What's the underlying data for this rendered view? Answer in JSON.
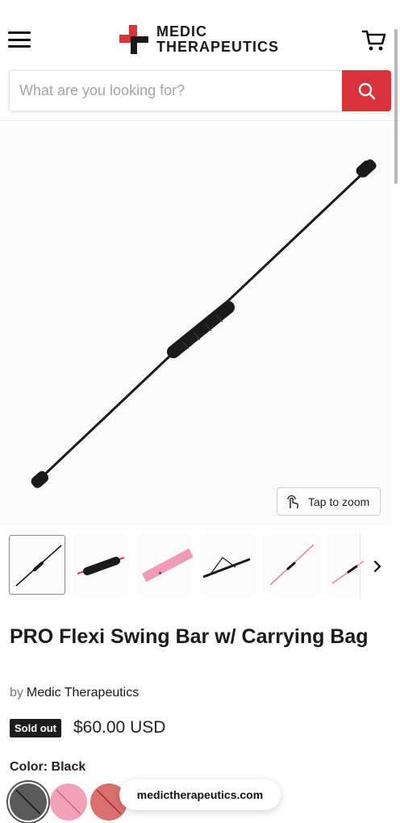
{
  "header": {
    "logo_line1": "MEDIC",
    "logo_line2": "THERAPEUTICS",
    "brand_red": "#d8333a",
    "search": {
      "placeholder": "What are you looking for?",
      "value": ""
    }
  },
  "product": {
    "zoom_label": "Tap to zoom",
    "title": "PRO Flexi Swing Bar w/ Carrying Bag",
    "vendor_prefix": "by",
    "vendor": "Medic Therapeutics",
    "badge": "Sold out",
    "price": "$60.00 USD",
    "color_label": "Color: Black",
    "colors": [
      {
        "swatch_color": "#5a5a5a",
        "selected": true
      },
      {
        "swatch_color": "#f0a3b8",
        "selected": false
      },
      {
        "swatch_color": "#d9706f",
        "selected": false
      }
    ],
    "thumbnails": [
      "bar-black",
      "grip-closeup-black",
      "bar-pink-branded",
      "bar-flexed",
      "bar-pink",
      "bar-pink-alt"
    ]
  },
  "browser": {
    "url": "medictherapeutics.com"
  }
}
